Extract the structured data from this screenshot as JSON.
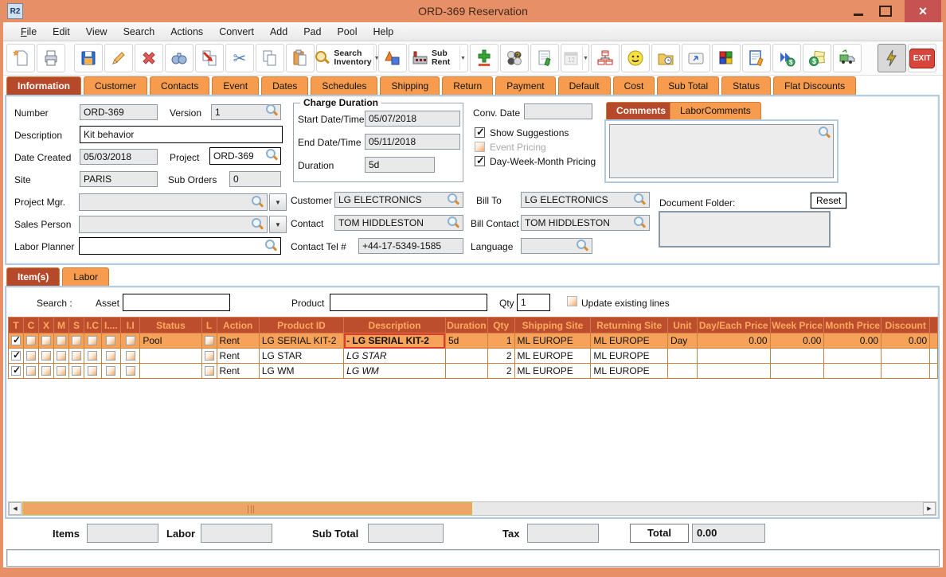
{
  "window": {
    "title": "ORD-369 Reservation",
    "icon_text": "R2"
  },
  "menu": {
    "items": [
      "File",
      "Edit",
      "View",
      "Search",
      "Actions",
      "Convert",
      "Add",
      "Pad",
      "Pool",
      "Help"
    ]
  },
  "toolbar": {
    "buttons": [
      "new-document",
      "print",
      "save",
      "edit",
      "delete",
      "find",
      "convert-document",
      "cut",
      "copy",
      "paste",
      "search-inventory",
      "shapes",
      "sub-rent",
      "add-remove",
      "option-circles",
      "notes",
      "calendar",
      "org-chart",
      "smiley",
      "folder-clock",
      "keyboard-key",
      "cubes",
      "document-edit",
      "send-dollar",
      "dollar-notes",
      "truck",
      "lightning",
      "exit"
    ],
    "search_inventory_line1": "Search",
    "search_inventory_line2": "Inventory",
    "sub_rent_label": "Sub Rent",
    "exit_label": "EXIT"
  },
  "tabs": {
    "selected": "Information",
    "items": [
      "Information",
      "Customer",
      "Contacts",
      "Event",
      "Dates",
      "Schedules",
      "Shipping",
      "Return",
      "Payment",
      "Default",
      "Cost",
      "Sub Total",
      "Status",
      "Flat Discounts"
    ]
  },
  "info": {
    "number_label": "Number",
    "number": "ORD-369",
    "version_label": "Version",
    "version": "1",
    "description_label": "Description",
    "description": "Kit behavior",
    "date_created_label": "Date Created",
    "date_created": "05/03/2018",
    "project_label": "Project",
    "project": "ORD-369",
    "site_label": "Site",
    "site": "PARIS",
    "sub_orders_label": "Sub Orders",
    "sub_orders": "0",
    "project_mgr_label": "Project Mgr.",
    "project_mgr": "",
    "sales_person_label": "Sales Person",
    "sales_person": "",
    "labor_planner_label": "Labor Planner",
    "labor_planner": "",
    "charge_duration": {
      "legend": "Charge Duration",
      "start_label": "Start Date/Time",
      "start": "05/07/2018",
      "end_label": "End Date/Time",
      "end": "05/11/2018",
      "duration_label": "Duration",
      "duration": "5d"
    },
    "conv_date_label": "Conv. Date",
    "conv_date": "",
    "show_suggestions_label": "Show Suggestions",
    "show_suggestions_checked": true,
    "event_pricing_label": "Event Pricing",
    "event_pricing_checked": false,
    "dwm_pricing_label": "Day-Week-Month Pricing",
    "dwm_pricing_checked": true,
    "customer_label": "Customer",
    "customer": "LG ELECTRONICS",
    "bill_to_label": "Bill To",
    "bill_to": "LG ELECTRONICS",
    "contact_label": "Contact",
    "contact": "TOM HIDDLESTON",
    "bill_contact_label": "Bill Contact",
    "bill_contact": "TOM HIDDLESTON",
    "contact_tel_label": "Contact Tel #",
    "contact_tel": "+44-17-5349-1585",
    "language_label": "Language",
    "language": "",
    "comments_tab": "Comments",
    "labor_comments_tab": "LaborComments",
    "comments_text": "",
    "document_folder_label": "Document Folder:",
    "reset_button": "Reset",
    "document_folder": ""
  },
  "items_section": {
    "tabs": [
      "Item(s)",
      "Labor"
    ],
    "selected": "Item(s)",
    "search_label": "Search :",
    "asset_label": "Asset",
    "asset": "",
    "product_label": "Product",
    "product": "",
    "qty_label": "Qty",
    "qty": "1",
    "update_lines_label": "Update existing lines",
    "update_lines_checked": false
  },
  "items_table": {
    "columns": [
      "T",
      "C",
      "X",
      "M",
      "S",
      "I.C",
      "I....",
      "I.I",
      "Status",
      "L",
      "Action",
      "Product ID",
      "Description",
      "Duration",
      "Qty",
      "Shipping Site",
      "Returning Site",
      "Unit",
      "Day/Each Price",
      "Week Price",
      "Month Price",
      "Discount"
    ],
    "rows": [
      {
        "t_checked": true,
        "l_checked": false,
        "selected": true,
        "status": "Pool",
        "action": "Rent",
        "product_id": "LG SERIAL KIT-2",
        "description": "-  LG SERIAL KIT-2",
        "duration": "5d",
        "qty": "1",
        "shipping_site": "ML EUROPE",
        "returning_site": "ML EUROPE",
        "unit": "Day",
        "day_each_price": "0.00",
        "week_price": "0.00",
        "month_price": "0.00",
        "discount": "0.00"
      },
      {
        "t_checked": true,
        "l_checked": false,
        "selected": false,
        "status": "",
        "action": "Rent",
        "product_id": "LG STAR",
        "description": "LG STAR",
        "duration": "",
        "qty": "2",
        "shipping_site": "ML EUROPE",
        "returning_site": "ML EUROPE",
        "unit": "",
        "day_each_price": "",
        "week_price": "",
        "month_price": "",
        "discount": ""
      },
      {
        "t_checked": true,
        "l_checked": false,
        "selected": false,
        "status": "",
        "action": "Rent",
        "product_id": "LG WM",
        "description": "LG WM",
        "duration": "",
        "qty": "2",
        "shipping_site": "ML EUROPE",
        "returning_site": "ML EUROPE",
        "unit": "",
        "day_each_price": "",
        "week_price": "",
        "month_price": "",
        "discount": ""
      }
    ]
  },
  "totals": {
    "items_label": "Items",
    "items": "",
    "labor_label": "Labor",
    "labor": "",
    "sub_total_label": "Sub Total",
    "sub_total": "",
    "tax_label": "Tax",
    "tax": "",
    "total_label": "Total",
    "total": "0.00"
  }
}
